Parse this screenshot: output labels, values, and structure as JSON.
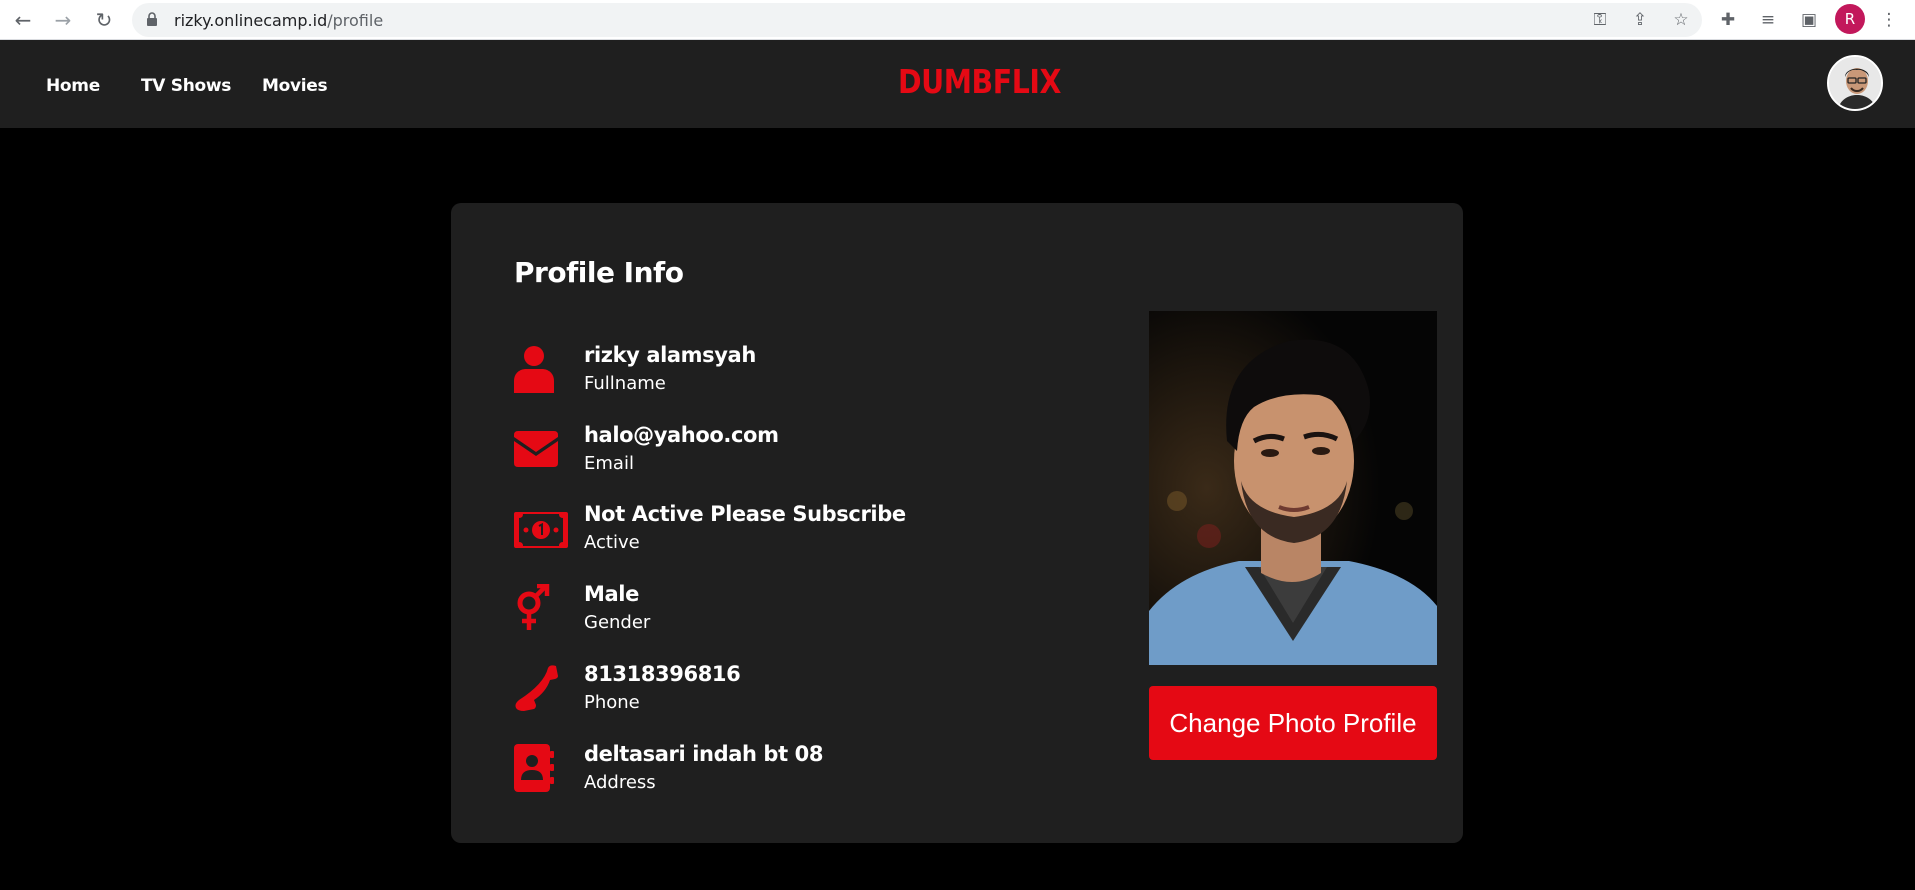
{
  "browser": {
    "url_domain": "rizky.onlinecamp.id",
    "url_path": "/profile",
    "profile_initial": "R",
    "icons": [
      "back-arrow-icon",
      "forward-arrow-icon",
      "reload-icon",
      "lock-icon",
      "key-icon",
      "share-icon",
      "star-icon",
      "extensions-icon",
      "reading-list-icon",
      "side-panel-icon",
      "menu-kebab-icon"
    ]
  },
  "navbar": {
    "links": [
      {
        "label": "Home"
      },
      {
        "label": "TV Shows"
      },
      {
        "label": "Movies"
      }
    ],
    "logo": "DUMBFLIX"
  },
  "profile": {
    "title": "Profile Info",
    "fields": [
      {
        "value": "rizky alamsyah",
        "label": "Fullname",
        "icon": "user-icon"
      },
      {
        "value": "halo@yahoo.com",
        "label": "Email",
        "icon": "envelope-icon"
      },
      {
        "value": "Not Active Please Subscribe",
        "label": "Active",
        "icon": "money-bill-icon"
      },
      {
        "value": "Male",
        "label": "Gender",
        "icon": "gender-icon"
      },
      {
        "value": "81318396816",
        "label": "Phone",
        "icon": "phone-icon"
      },
      {
        "value": "deltasari indah bt 08",
        "label": "Address",
        "icon": "address-book-icon"
      }
    ],
    "change_photo_label": "Change Photo Profile"
  },
  "colors": {
    "accent": "#e50914",
    "navbar_bg": "#1f1f1f",
    "card_bg": "#1f1f1f",
    "page_bg": "#000000"
  }
}
